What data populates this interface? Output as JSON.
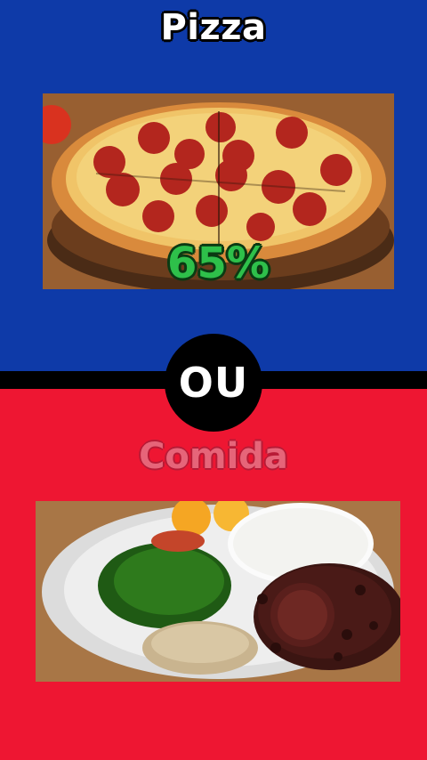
{
  "colors": {
    "top_bg": "#0e3aa8",
    "bottom_bg": "#ee1632",
    "divider": "#000000",
    "percent_green": "#2ec04a"
  },
  "option_a": {
    "title": "Pizza",
    "percent": "65%",
    "image": "pepperoni-pizza"
  },
  "separator": {
    "label": "OU"
  },
  "option_b": {
    "title": "Comida",
    "image": "feijoada-plate"
  }
}
